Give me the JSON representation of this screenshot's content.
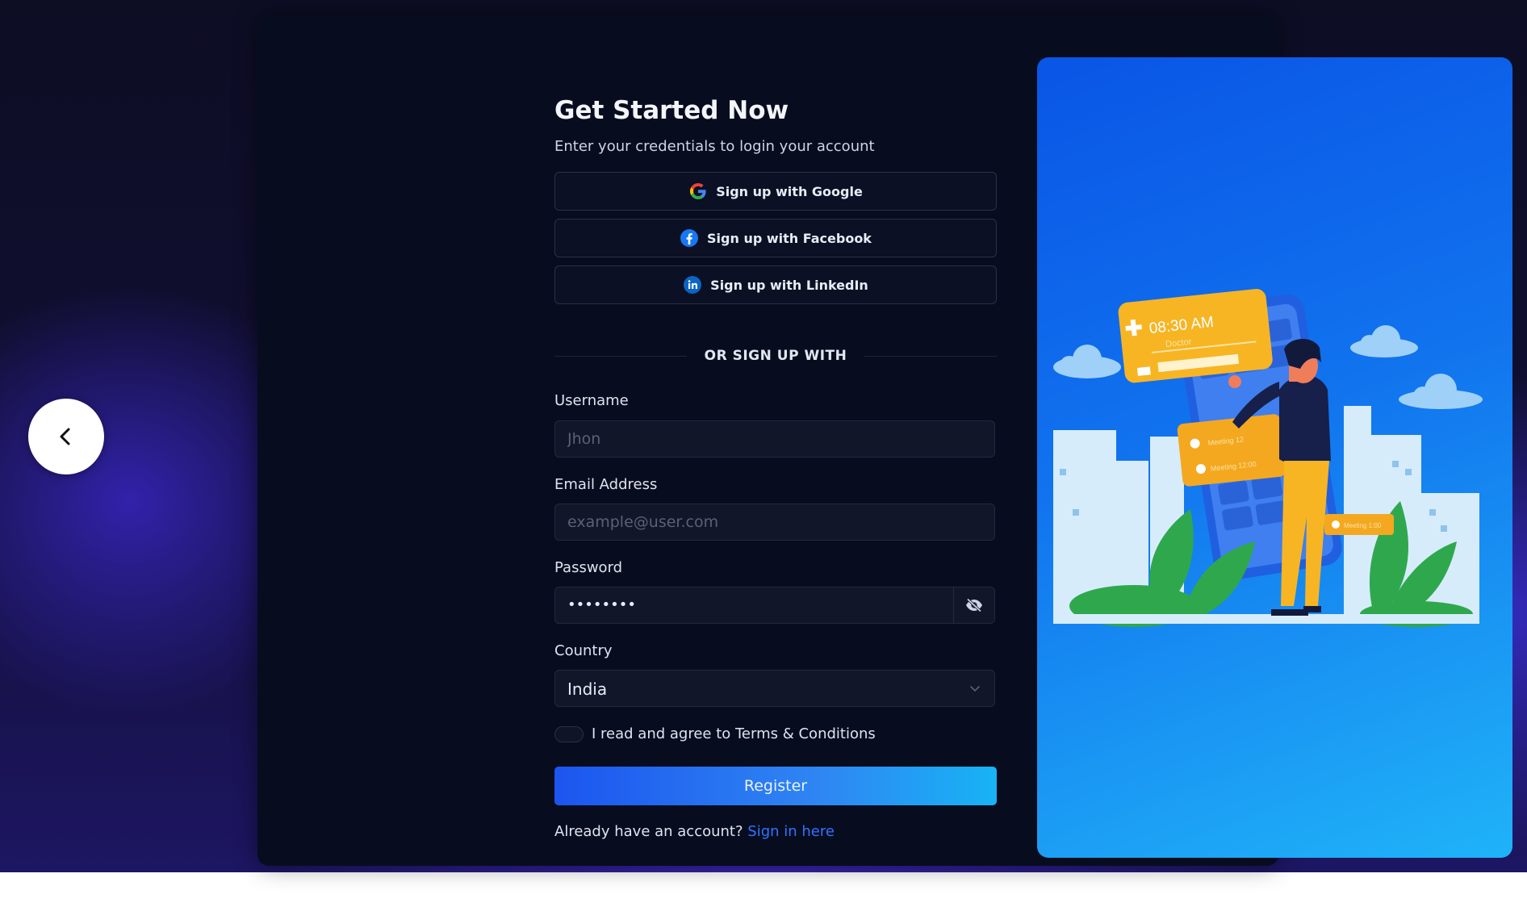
{
  "form": {
    "title": "Get Started Now",
    "subtitle": "Enter your credentials to login your account",
    "social": [
      {
        "label": "Sign up with Google",
        "icon": "google-icon"
      },
      {
        "label": "Sign up with Facebook",
        "icon": "facebook-icon"
      },
      {
        "label": "Sign up with LinkedIn",
        "icon": "linkedin-icon"
      }
    ],
    "divider": "OR SIGN UP WITH",
    "username": {
      "label": "Username",
      "placeholder": "Jhon"
    },
    "email": {
      "label": "Email Address",
      "placeholder": "example@user.com"
    },
    "password": {
      "label": "Password",
      "value": "••••••••"
    },
    "country": {
      "label": "Country",
      "value": "India"
    },
    "terms": "I read and agree to Terms & Conditions",
    "register": "Register",
    "signin": {
      "prompt": "Already have an account?",
      "link": "Sign in here"
    }
  },
  "illustration": {
    "card_time": "08:30 AM",
    "card_sub": "Doctor",
    "meeting_1": "Meeting 12",
    "meeting_2": "Meeting 12:00",
    "meeting_3": "Meeting 1:00"
  },
  "nav": {
    "prev_icon": "chevron-left-icon",
    "next_icon": "chevron-right-icon"
  },
  "colors": {
    "accent": "#1c55ef",
    "link": "#2f74ff",
    "card_bg": "#080c1f",
    "panel_blue": "#1173ee",
    "illustration_yellow": "#f7b524"
  }
}
